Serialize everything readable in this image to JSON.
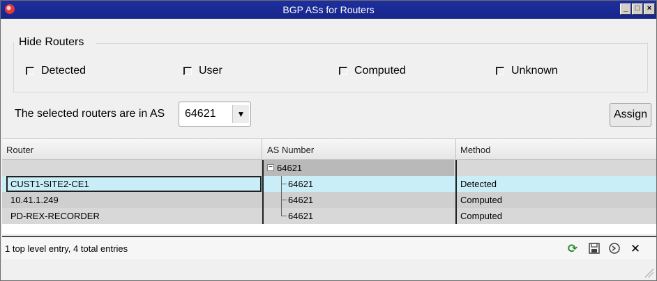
{
  "window": {
    "title": "BGP ASs for Routers"
  },
  "hide_routers": {
    "legend": "Hide Routers",
    "options": [
      {
        "label": "Detected",
        "checked": false
      },
      {
        "label": "User",
        "checked": false
      },
      {
        "label": "Computed",
        "checked": false
      },
      {
        "label": "Unknown",
        "checked": false
      }
    ]
  },
  "as_selector": {
    "label": "The selected routers are in AS",
    "value": "64621"
  },
  "assign_button": {
    "label": "Assign"
  },
  "table": {
    "columns": [
      "Router",
      "AS Number",
      "Method"
    ],
    "group": {
      "as": "64621"
    },
    "rows": [
      {
        "router": "CUST1-SITE2-CE1",
        "as": "64621",
        "method": "Detected"
      },
      {
        "router": "10.41.1.249",
        "as": "64621",
        "method": "Computed"
      },
      {
        "router": "PD-REX-RECORDER",
        "as": "64621",
        "method": "Computed"
      }
    ]
  },
  "status": {
    "text": "1 top level entry, 4 total entries"
  },
  "toolbar": {
    "icons": [
      "refresh-icon",
      "save-icon",
      "undo-icon",
      "close-icon"
    ]
  },
  "colors": {
    "titlebar": "#17268a",
    "selected_row": "#c9eef8",
    "refresh_icon": "#2a8a2a"
  }
}
